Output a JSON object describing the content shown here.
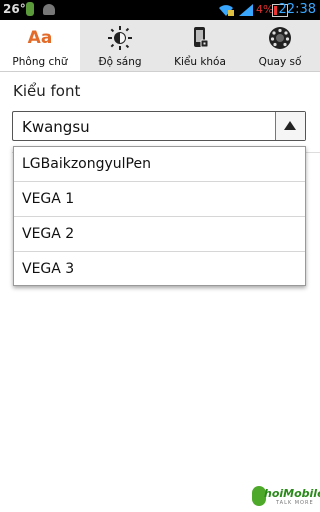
{
  "statusbar": {
    "temperature": "26°",
    "battery_percent": "4%",
    "time": "22:38"
  },
  "tabs": [
    {
      "label": "Phông chữ",
      "icon": "font-aa-icon",
      "glyph": "Aa",
      "active": true
    },
    {
      "label": "Độ sáng",
      "icon": "brightness-icon",
      "active": false
    },
    {
      "label": "Kiểu khóa",
      "icon": "lock-screen-icon",
      "active": false
    },
    {
      "label": "Quay số",
      "icon": "dial-icon",
      "active": false
    }
  ],
  "content": {
    "section_label": "Kiểu font",
    "selected_font": "Kwangsu"
  },
  "dropdown": {
    "options": [
      "LGBaikzongyulPen",
      "VEGA 1",
      "VEGA 2",
      "VEGA 3"
    ]
  },
  "watermark": {
    "brand": "hoiMobile",
    "tagline": "TALK MORE"
  },
  "colors": {
    "accent_orange": "#e36b2a",
    "clock_blue": "#3aa7ff",
    "tab_bg": "#e7e7e7"
  }
}
